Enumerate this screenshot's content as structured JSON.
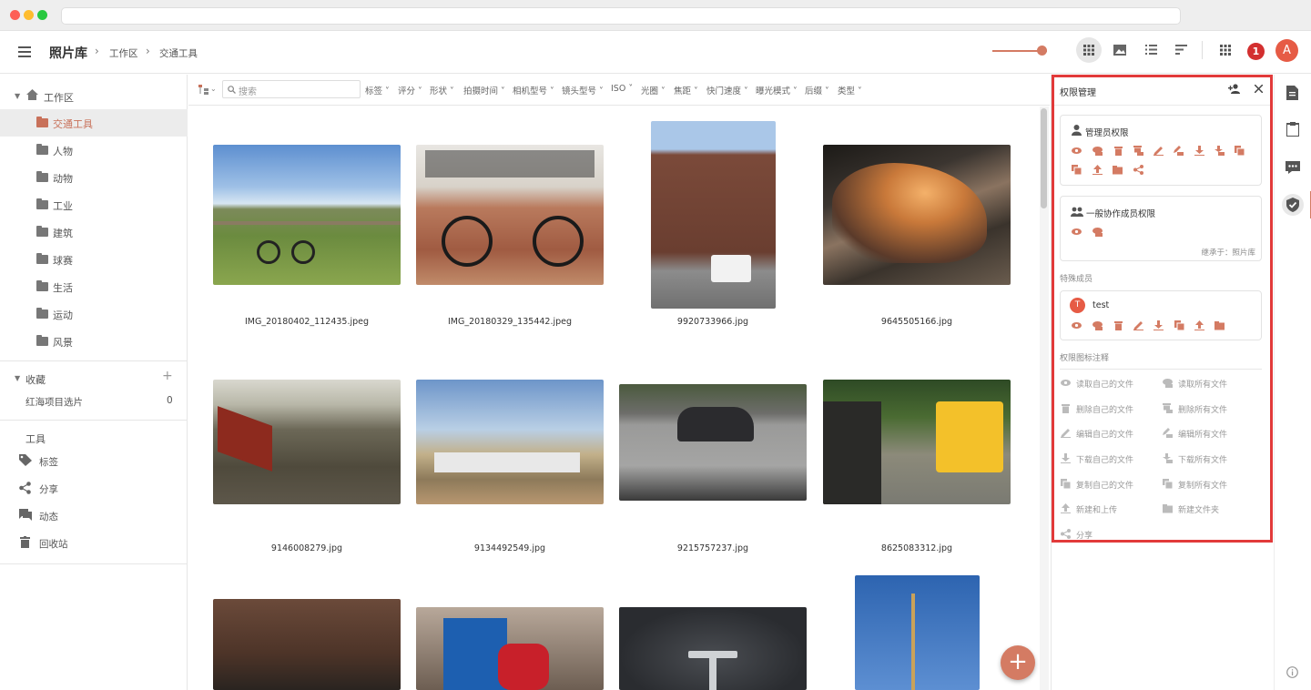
{
  "app": {
    "title": "照片库",
    "breadcrumb": [
      "工作区",
      "交通工具"
    ],
    "avatar_letter": "A",
    "notif_count": "1",
    "accent": "#d47b63"
  },
  "sidebar": {
    "root": "工作区",
    "folders": [
      "交通工具",
      "人物",
      "动物",
      "工业",
      "建筑",
      "球赛",
      "生活",
      "运动",
      "风景"
    ],
    "selected": "交通工具",
    "favorites_title": "收藏",
    "favorites": [
      {
        "label": "红海项目选片",
        "count": "0"
      }
    ],
    "tools_title": "工具",
    "tools": [
      {
        "label": "标签",
        "icon": "tag-icon"
      },
      {
        "label": "分享",
        "icon": "share-icon"
      },
      {
        "label": "动态",
        "icon": "chat-icon"
      },
      {
        "label": "回收站",
        "icon": "trash-icon"
      }
    ]
  },
  "filters": {
    "search_placeholder": "搜索",
    "items": [
      "标签",
      "评分",
      "形状",
      "拍摄时间",
      "相机型号",
      "镜头型号",
      "ISO",
      "光圈",
      "焦距",
      "快门速度",
      "曝光模式",
      "后缀",
      "类型"
    ]
  },
  "photos": [
    {
      "name": "IMG_20180402_112435.jpeg",
      "scene": "countryside-bike"
    },
    {
      "name": "IMG_20180329_135442.jpeg",
      "scene": "graffiti-bike"
    },
    {
      "name": "9920733966.jpg",
      "scene": "street"
    },
    {
      "name": "9645505166.jpg",
      "scene": "car-orange"
    },
    {
      "name": "9146008279.jpg",
      "scene": "train"
    },
    {
      "name": "9134492549.jpg",
      "scene": "boats"
    },
    {
      "name": "9215757237.jpg",
      "scene": "car-motion"
    },
    {
      "name": "8625083312.jpg",
      "scene": "school-bus"
    },
    {
      "name": "",
      "scene": "brick-building"
    },
    {
      "name": "",
      "scene": "bins-scooter"
    },
    {
      "name": "",
      "scene": "tesla"
    },
    {
      "name": "",
      "scene": "mast"
    }
  ],
  "panel": {
    "title": "权限管理",
    "admin_title": "管理员权限",
    "general_title": "一般协作成员权限",
    "inherit_text": "继承于：照片库",
    "special_title": "特殊成员",
    "special_member": {
      "name": "test",
      "initial": "T"
    },
    "legend_title": "权限图标注释",
    "legend": [
      [
        "读取自己的文件",
        "读取所有文件"
      ],
      [
        "删除自己的文件",
        "删除所有文件"
      ],
      [
        "编辑自己的文件",
        "编辑所有文件"
      ],
      [
        "下载自己的文件",
        "下载所有文件"
      ],
      [
        "复制自己的文件",
        "复制所有文件"
      ],
      [
        "新建和上传",
        "新建文件夹"
      ],
      [
        "分享",
        ""
      ]
    ]
  }
}
